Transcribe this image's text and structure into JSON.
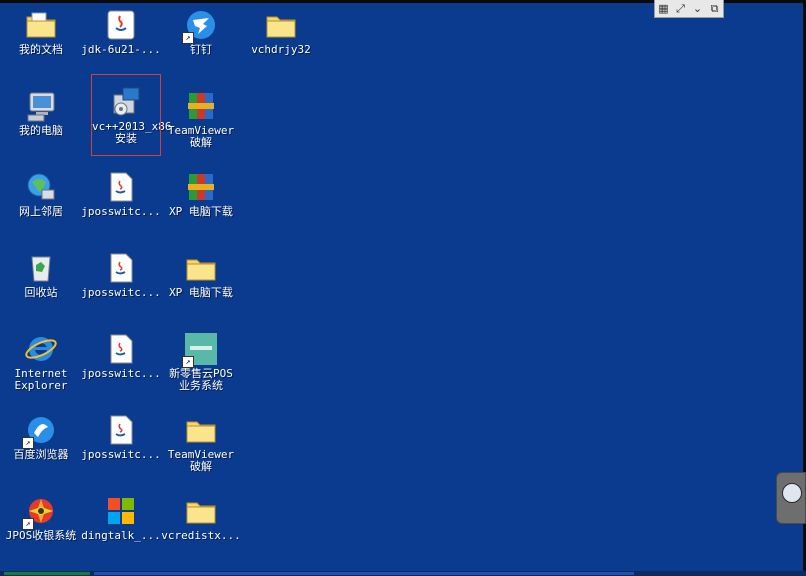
{
  "desktop": {
    "icons": [
      {
        "name": "my-documents",
        "label": "我的文档",
        "icon": "folder-docs-icon"
      },
      {
        "name": "jdk",
        "label": "jdk-6u21-...",
        "icon": "java-installer-icon"
      },
      {
        "name": "dingding",
        "label": "钉钉",
        "icon": "dingtalk-icon"
      },
      {
        "name": "vchdrjy32",
        "label": "vchdrjy32",
        "icon": "folder-icon"
      },
      {
        "name": "my-computer",
        "label": "我的电脑",
        "icon": "computer-icon"
      },
      {
        "name": "vcpp-2013",
        "label": "vc++2013_x86\n安装",
        "icon": "installer-icon"
      },
      {
        "name": "teamviewer-crack-1",
        "label": "TeamViewer\n破解",
        "icon": "winrar-archive-icon"
      },
      {
        "name": "network-places",
        "label": "网上邻居",
        "icon": "network-icon"
      },
      {
        "name": "jposswitch-1",
        "label": "jposswitc...",
        "icon": "java-file-icon"
      },
      {
        "name": "xp-download-1",
        "label": "XP  电脑下载",
        "icon": "winrar-archive-icon"
      },
      {
        "name": "recycle-bin",
        "label": "回收站",
        "icon": "recycle-bin-icon"
      },
      {
        "name": "jposswitch-2",
        "label": "jposswitc...",
        "icon": "java-file-icon"
      },
      {
        "name": "xp-download-2",
        "label": "XP  电脑下载",
        "icon": "folder-icon"
      },
      {
        "name": "internet-explorer",
        "label": "Internet\nExplorer",
        "icon": "ie-icon"
      },
      {
        "name": "jposswitch-3",
        "label": "jposswitc...",
        "icon": "java-file-icon"
      },
      {
        "name": "xinlingshou-pos",
        "label": "新零售云POS\n业务系统",
        "icon": "pos-app-icon"
      },
      {
        "name": "baidu-browser",
        "label": "百度浏览器",
        "icon": "baidu-browser-icon"
      },
      {
        "name": "jposswitch-4",
        "label": "jposswitc...",
        "icon": "java-file-icon"
      },
      {
        "name": "teamviewer-crack-2",
        "label": "TeamViewer\n破解",
        "icon": "folder-icon"
      },
      {
        "name": "jpos-cashier",
        "label": "JPOS收银系统",
        "icon": "jpos-icon"
      },
      {
        "name": "dingtalk-installer",
        "label": "dingtalk_...",
        "icon": "dingtalk-installer-icon"
      },
      {
        "name": "vcredist",
        "label": "vcredistx...",
        "icon": "folder-icon"
      }
    ]
  },
  "remote_bar": {
    "grid_glyph": "▦",
    "fullscreen_glyph": "⤢",
    "chevron_glyph": "⌄",
    "monitor_glyph": "⧉"
  },
  "colors": {
    "desktop_bg": "#0b3b8e",
    "selection_outline": "#d04040"
  }
}
